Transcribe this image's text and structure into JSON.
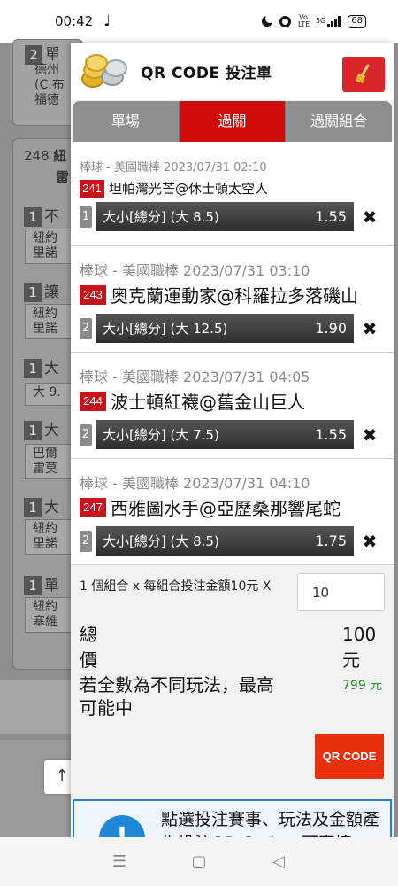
{
  "status": {
    "time": "00:42",
    "network": "5G",
    "volte": "Vo LTE",
    "battery": "68"
  },
  "background": {
    "cards": [
      {
        "badge": "2",
        "text": "單"
      },
      {
        "badge": "",
        "text": "德州"
      },
      {
        "badge": "",
        "text": "(C.布"
      },
      {
        "badge": "",
        "text": "福德"
      }
    ],
    "event_no": "248",
    "event_title_1": "紐",
    "event_title_2": "雷",
    "rows": [
      {
        "badge": "1",
        "text": "不",
        "sub1": "紐約",
        "sub2": "里諾"
      },
      {
        "badge": "1",
        "text": "讓",
        "sub1": "紐約",
        "sub2": "里諾"
      },
      {
        "badge": "1",
        "text": "大",
        "sub1": "大 9.",
        "sub2": ""
      },
      {
        "badge": "1",
        "text": "大",
        "sub1": "巴爾",
        "sub2": "雷莫"
      },
      {
        "badge": "1",
        "text": "大",
        "sub1": "紐約",
        "sub2": "里諾"
      },
      {
        "badge": "1",
        "text": "單",
        "sub1": "紐約",
        "sub2": "塞維"
      }
    ],
    "scroll_top_icon": "↑"
  },
  "panel": {
    "title": "QR CODE 投注單",
    "logo_icon": "coins-icon",
    "clear_icon": "broom-icon",
    "tabs": [
      {
        "label": "單場",
        "active": false
      },
      {
        "label": "過關",
        "active": true
      },
      {
        "label": "過關組合",
        "active": false
      }
    ],
    "bets": [
      {
        "meta": "棒球 - 美國職棒 2023/07/31 02:10",
        "game_no": "241",
        "match": "坦帕灣光芒@休士頓太空人",
        "pick_index": "1",
        "pick": "大小[總分] (大 8.5)",
        "odds": "1.55"
      },
      {
        "meta": "棒球 - 美國職棒 2023/07/31 03:10",
        "game_no": "243",
        "match": "奧克蘭運動家@科羅拉多落磯山",
        "pick_index": "2",
        "pick": "大小[總分] (大 12.5)",
        "odds": "1.90"
      },
      {
        "meta": "棒球 - 美國職棒 2023/07/31 04:05",
        "game_no": "244",
        "match": "波士頓紅襪@舊金山巨人",
        "pick_index": "2",
        "pick": "大小[總分] (大 7.5)",
        "odds": "1.55"
      },
      {
        "meta": "棒球 - 美國職棒 2023/07/31 04:10",
        "game_no": "247",
        "match": "西雅圖水手@亞歷桑那響尾蛇",
        "pick_index": "2",
        "pick": "大小[總分] (大 8.5)",
        "odds": "1.75"
      }
    ],
    "remove_icon": "✖",
    "summary": {
      "combo_text": "1 個組合 x 每組合投注金額10元 X",
      "amount": "10",
      "total_label": "總價",
      "total_value": "100元",
      "maxwin_label": "若全數為不同玩法，最高可能中",
      "maxwin_value": "799 元",
      "qr_button": "QR CODE"
    },
    "notice": {
      "icon": "!",
      "text": "點選投注賽事、玩法及金額產生投注QR Code，可直接"
    }
  },
  "navbar": {
    "menu_icon": "☰",
    "home_icon": "▢",
    "back_icon": "◁"
  },
  "colors": {
    "accent_red": "#d10b0b",
    "tab_gray": "#8f8f8f",
    "green": "#2a8a2a",
    "notice_blue": "#2b7bd6"
  }
}
